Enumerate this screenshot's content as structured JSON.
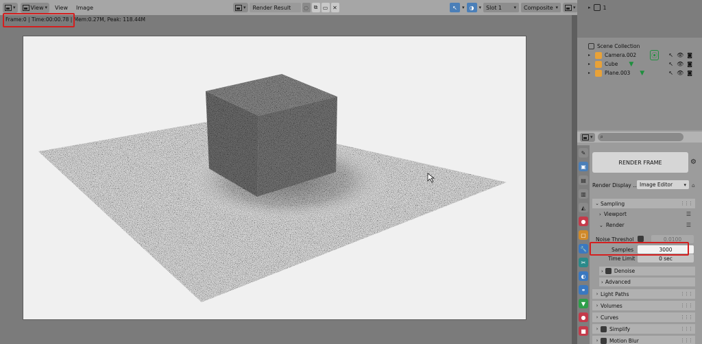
{
  "editor": {
    "menu_view_dropdown": "View",
    "menu_view": "View",
    "menu_image": "Image",
    "image_name": "Render Result",
    "slot": "Slot 1",
    "layer": "Composite",
    "stats": "Frame:0 | Time:00:00.78 | Mem:0.27M, Peak: 118.44M"
  },
  "outliner": {
    "top_count": "1",
    "collection": "Scene Collection",
    "objects": [
      {
        "name": "Camera.002",
        "color": "#e8a238"
      },
      {
        "name": "Cube",
        "color": "#e8a238"
      },
      {
        "name": "Plane.003",
        "color": "#e8a238"
      }
    ]
  },
  "properties": {
    "render_frame": "RENDER FRAME",
    "render_display_label": "Render Display ...",
    "render_display_value": "Image Editor",
    "sampling": "Sampling",
    "viewport": "Viewport",
    "render": "Render",
    "noise_threshold_label": "Noise Threshol",
    "noise_threshold_value": "0.0100",
    "samples_label": "Samples",
    "samples_value": "3000",
    "time_limit_label": "Time Limit",
    "time_limit_value": "0 sec",
    "denoise": "Denoise",
    "advanced": "Advanced",
    "light_paths": "Light Paths",
    "volumes": "Volumes",
    "curves": "Curves",
    "simplify": "Simplify",
    "motion_blur": "Motion Blur"
  },
  "icons": {
    "editor_type": "image-editor-icon",
    "search": "search-icon",
    "eye": "eye-icon",
    "camera": "camera-icon"
  },
  "colors": {
    "highlight": "#d41e1e",
    "accent_blue": "#4b7fb8"
  }
}
